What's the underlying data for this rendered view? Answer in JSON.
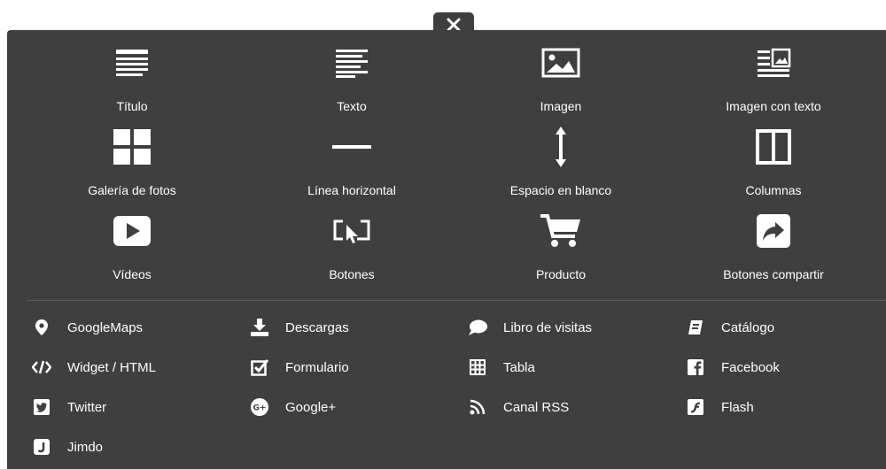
{
  "close": {
    "icon": "close-icon"
  },
  "tiles": [
    {
      "label": "Título",
      "icon": "title-icon"
    },
    {
      "label": "Texto",
      "icon": "text-icon"
    },
    {
      "label": "Imagen",
      "icon": "image-icon"
    },
    {
      "label": "Imagen con texto",
      "icon": "image-text-icon"
    },
    {
      "label": "Galería de fotos",
      "icon": "gallery-icon"
    },
    {
      "label": "Línea horizontal",
      "icon": "horizontal-line-icon"
    },
    {
      "label": "Espacio en blanco",
      "icon": "vertical-space-icon"
    },
    {
      "label": "Columnas",
      "icon": "columns-icon"
    },
    {
      "label": "Vídeos",
      "icon": "video-icon"
    },
    {
      "label": "Botones",
      "icon": "button-cursor-icon"
    },
    {
      "label": "Producto",
      "icon": "cart-icon"
    },
    {
      "label": "Botones compartir",
      "icon": "share-icon"
    }
  ],
  "list_items": [
    {
      "label": "GoogleMaps",
      "icon": "map-pin-icon"
    },
    {
      "label": "Descargas",
      "icon": "download-icon"
    },
    {
      "label": "Libro de visitas",
      "icon": "chat-bubble-icon"
    },
    {
      "label": "Catálogo",
      "icon": "catalog-icon"
    },
    {
      "label": "Widget / HTML",
      "icon": "code-icon"
    },
    {
      "label": "Formulario",
      "icon": "checkbox-icon"
    },
    {
      "label": "Tabla",
      "icon": "table-icon"
    },
    {
      "label": "Facebook",
      "icon": "facebook-icon"
    },
    {
      "label": "Twitter",
      "icon": "twitter-icon"
    },
    {
      "label": "Google+",
      "icon": "google-plus-icon"
    },
    {
      "label": "Canal RSS",
      "icon": "rss-icon"
    },
    {
      "label": "Flash",
      "icon": "flash-icon"
    },
    {
      "label": "Jimdo",
      "icon": "jimdo-icon"
    }
  ],
  "colors": {
    "panel": "#3f3f3f",
    "text": "#ffffff",
    "divider": "#5a5a5a"
  }
}
